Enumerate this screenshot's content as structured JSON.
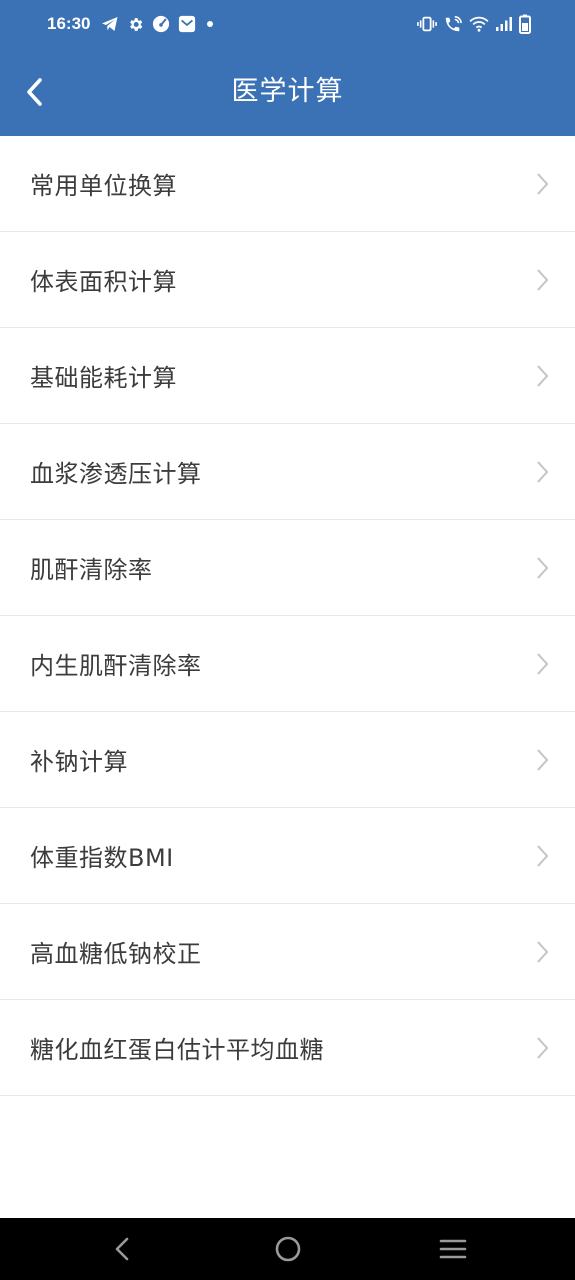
{
  "status_bar": {
    "time": "16:30",
    "left_icons": [
      "telegram-icon",
      "gear-icon",
      "gauge-icon",
      "mail-icon",
      "dot-icon"
    ],
    "right_icons": [
      "vibrate-icon",
      "wifi-call-icon",
      "wifi-icon",
      "signal-icon",
      "battery-icon"
    ]
  },
  "app_bar": {
    "title": "医学计算",
    "back_icon": "chevron-left-icon"
  },
  "menu": {
    "items": [
      {
        "label": "常用单位换算"
      },
      {
        "label": "体表面积计算"
      },
      {
        "label": "基础能耗计算"
      },
      {
        "label": "血浆渗透压计算"
      },
      {
        "label": "肌酐清除率"
      },
      {
        "label": "内生肌酐清除率"
      },
      {
        "label": "补钠计算"
      },
      {
        "label": "体重指数BMI"
      },
      {
        "label": "高血糖低钠校正"
      },
      {
        "label": "糖化血红蛋白估计平均血糖"
      }
    ]
  },
  "nav_bar": {
    "buttons": [
      "nav-back-icon",
      "home-icon",
      "recents-menu-icon"
    ]
  },
  "colors": {
    "primary": "#3a72b5",
    "text": "#3c3c3c",
    "divider": "#e8e8e8",
    "chevron": "#c4c4c4"
  }
}
